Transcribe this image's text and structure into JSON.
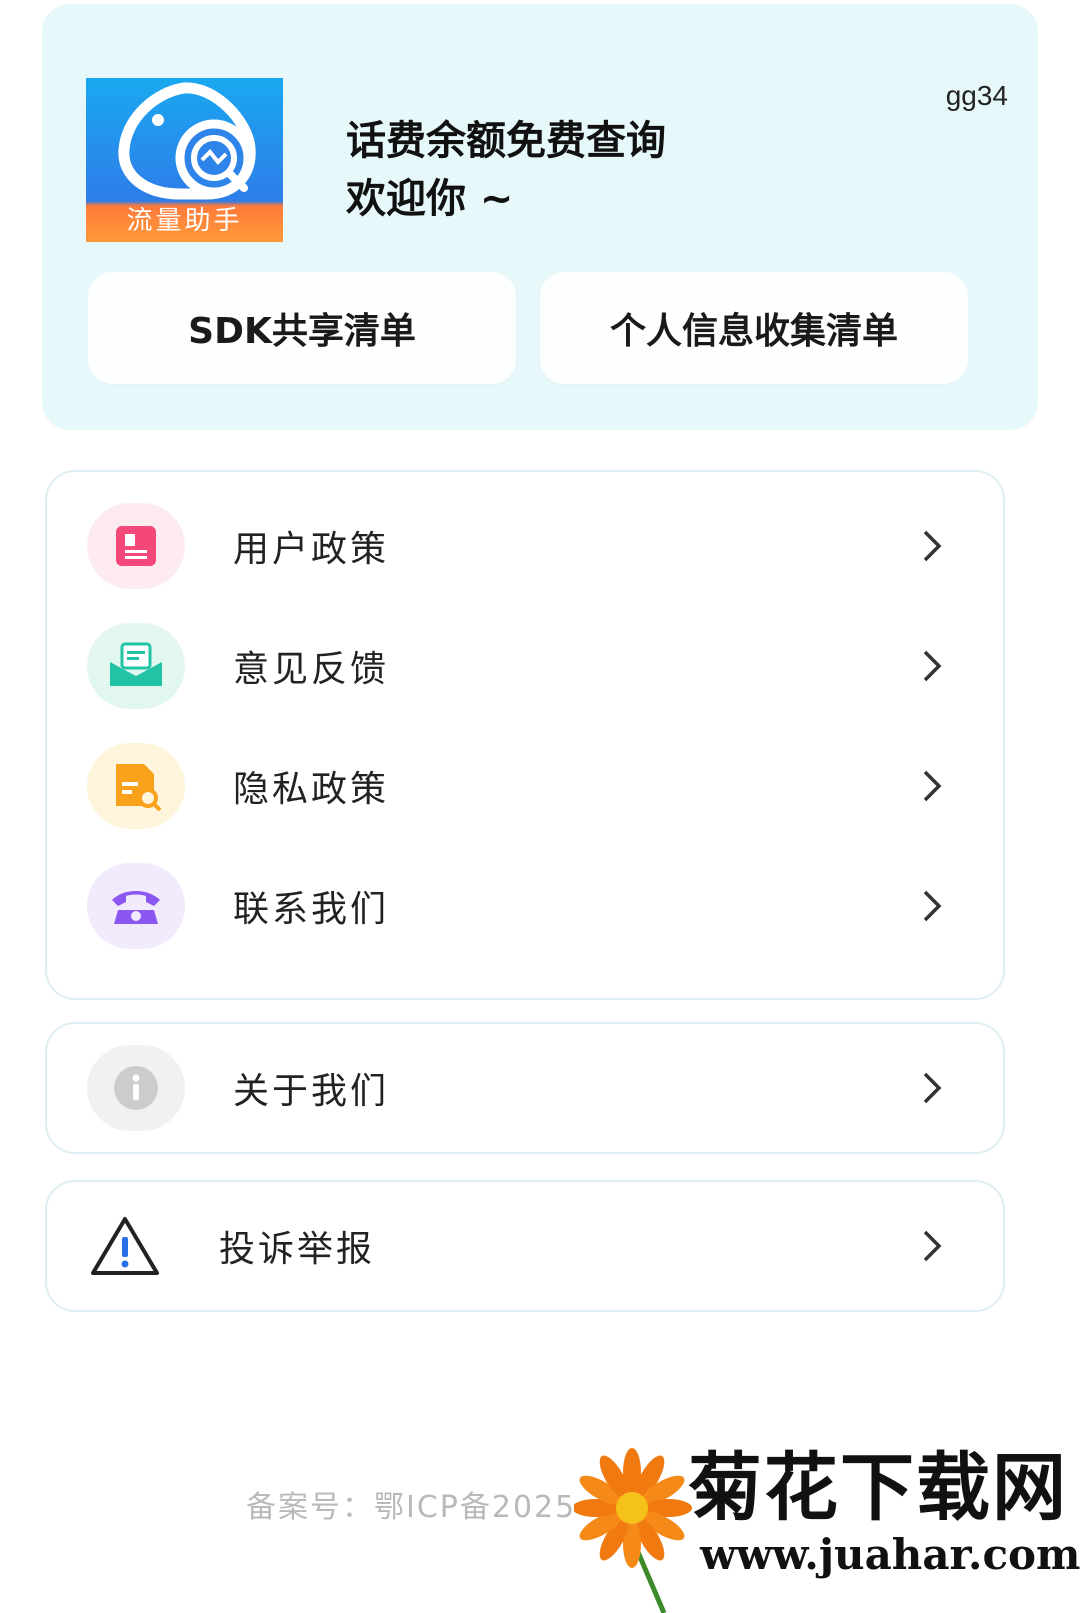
{
  "header": {
    "logo_text": "流量助手",
    "user_id": "gg34",
    "title_line1": "话费余额免费查询",
    "title_line2": "欢迎你 ~",
    "buttons": {
      "sdk_list": "SDK共享清单",
      "personal_info_list": "个人信息收集清单"
    }
  },
  "menu": {
    "items": [
      {
        "label": "用户政策",
        "icon": "user-policy-icon",
        "color": "#f4477a"
      },
      {
        "label": "意见反馈",
        "icon": "feedback-icon",
        "color": "#21c3a4"
      },
      {
        "label": "隐私政策",
        "icon": "privacy-policy-icon",
        "color": "#f8a21c"
      },
      {
        "label": "联系我们",
        "icon": "phone-icon",
        "color": "#8b57f0"
      }
    ],
    "about": {
      "label": "关于我们",
      "icon": "info-icon"
    },
    "report": {
      "label": "投诉举报",
      "icon": "warning-icon"
    }
  },
  "footer": {
    "icp": "备案号：鄂ICP备2025"
  },
  "watermark": {
    "title": "菊花下载网",
    "url": "www.juahar.com"
  }
}
